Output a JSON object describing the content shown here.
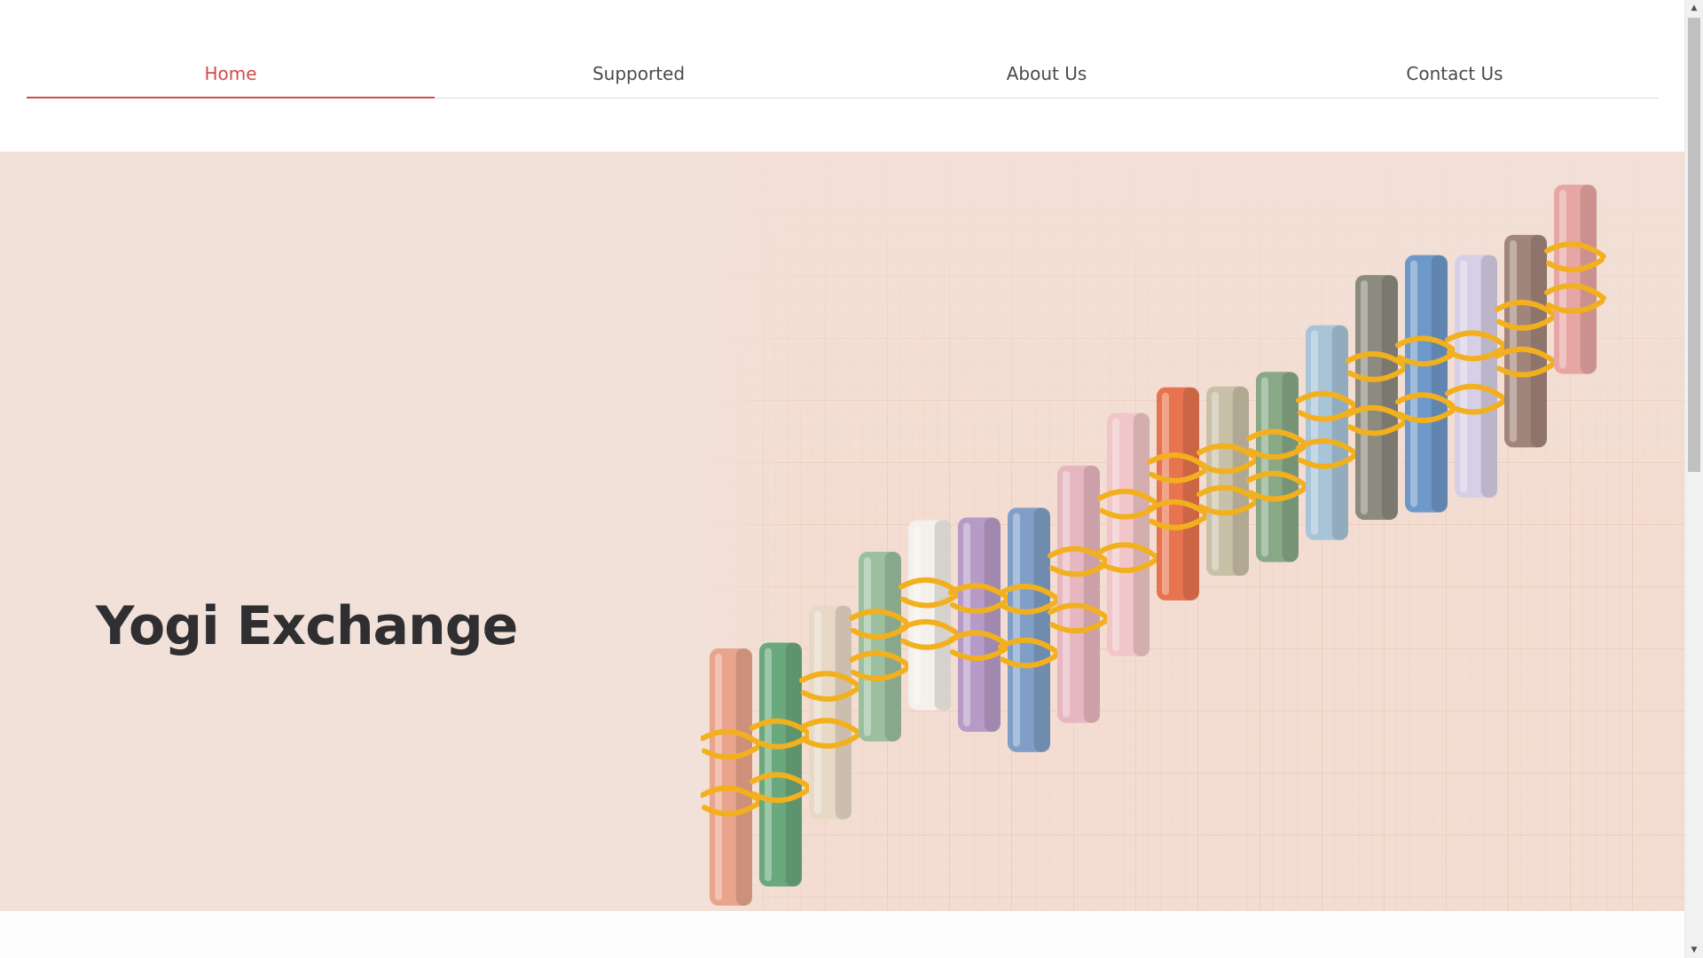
{
  "nav": {
    "items": [
      {
        "label": "Home",
        "active": true
      },
      {
        "label": "Supported",
        "active": false
      },
      {
        "label": "About Us",
        "active": false
      },
      {
        "label": "Contact Us",
        "active": false
      }
    ]
  },
  "hero": {
    "title": "Yogi Exchange",
    "image": "rolled-currency-banknotes-rising-chart"
  },
  "colors": {
    "accent": "#d24b4b",
    "nav_text": "#4a4a4a",
    "hero_bg": "#f2e1d9",
    "title_text": "#2f2f31"
  },
  "icons": {
    "scroll_up": "triangle-up-icon",
    "scroll_down": "triangle-down-icon"
  },
  "scroll": {
    "position": 0.0
  }
}
